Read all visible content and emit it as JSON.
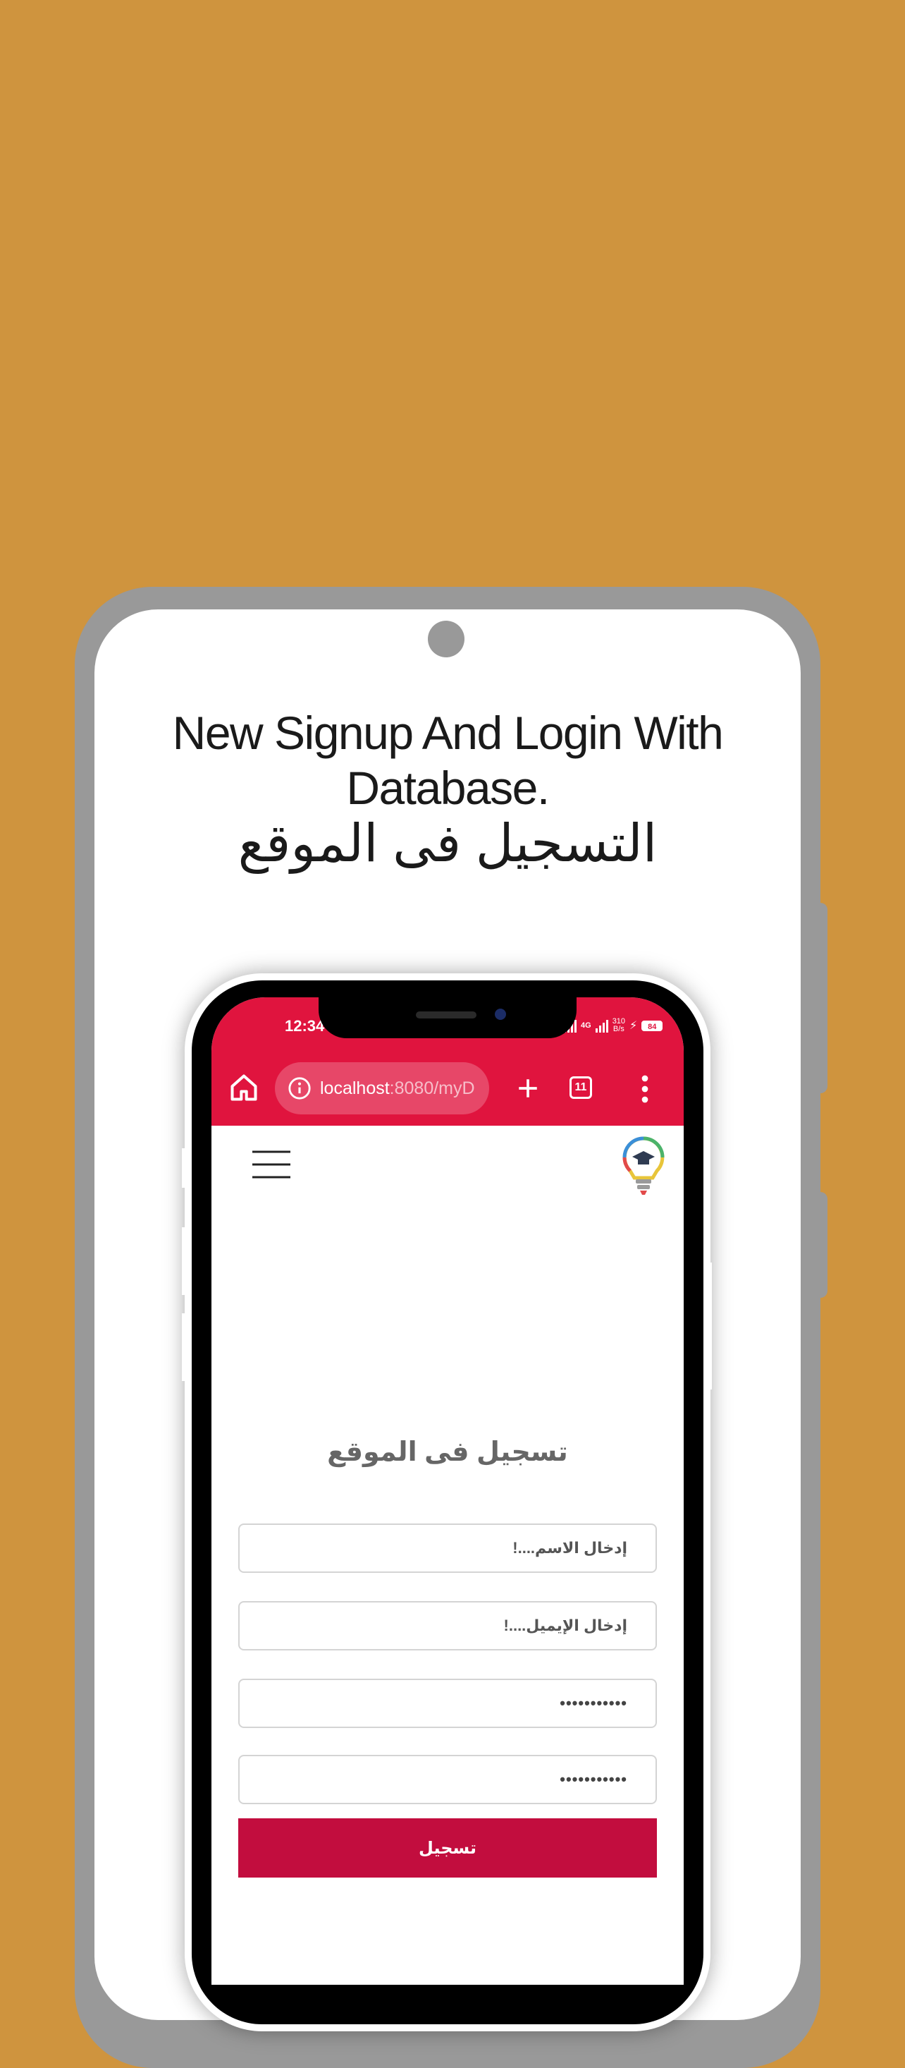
{
  "headline": {
    "line1": "New Signup And Login With",
    "line2": "Database.",
    "arabic": "التسجيل فى الموقع"
  },
  "status_bar": {
    "time": "12:34",
    "network": "4G",
    "speed_value": "310",
    "speed_unit": "B/s",
    "battery": "84"
  },
  "browser": {
    "url_host": "localhost",
    "url_path": ":8080/myD",
    "tab_count": "11"
  },
  "form": {
    "title": "تسجيل فى الموقع",
    "name_placeholder": "إدخال الاسم....!",
    "email_placeholder": "إدخال الإيميل....!",
    "password_value": "•••••••••••",
    "confirm_password_value": "•••••••••••",
    "submit_label": "تسجيل"
  },
  "colors": {
    "background": "#cf943e",
    "browser_bar": "#e0143e",
    "submit_button": "#c20d3e",
    "phone_frame": "#999999"
  }
}
